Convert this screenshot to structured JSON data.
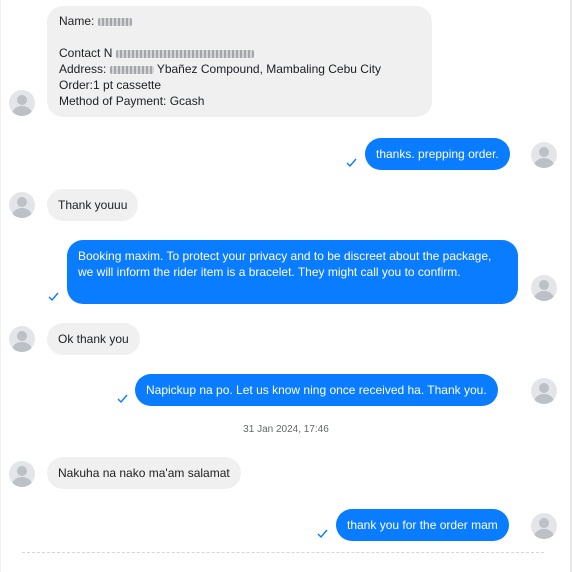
{
  "conversation": {
    "order_message": {
      "name_label": "Name:",
      "contact_label": "Contact N",
      "address_label": "Address:",
      "address_visible": "Ybañez Compound, Mambaling Cebu City",
      "order_line": "Order:1 pt cassette",
      "payment_line": "Method of Payment: Gcash"
    },
    "messages": [
      {
        "direction": "out",
        "text": "thanks. prepping order."
      },
      {
        "direction": "in",
        "text": "Thank youuu"
      },
      {
        "direction": "out",
        "text": "Booking maxim. To protect your privacy and to be discreet about the package, we will inform the rider item is a bracelet. They might call you to confirm."
      },
      {
        "direction": "in",
        "text": "Ok thank you"
      },
      {
        "direction": "out",
        "text": "Napickup na po. Let us know ning once received ha. Thank you."
      },
      {
        "direction": "in",
        "text": "Nakuha na nako ma'am salamat"
      },
      {
        "direction": "out",
        "text": "thank you for the order mam"
      }
    ],
    "timestamp": "31 Jan 2024, 17:46"
  },
  "colors": {
    "outgoing_bubble": "#0a7cff",
    "incoming_bubble": "#f0f0f0",
    "read_check": "#0a7cff"
  },
  "icons": {
    "avatar": "default-user-avatar-icon",
    "read_receipt": "check-icon"
  }
}
